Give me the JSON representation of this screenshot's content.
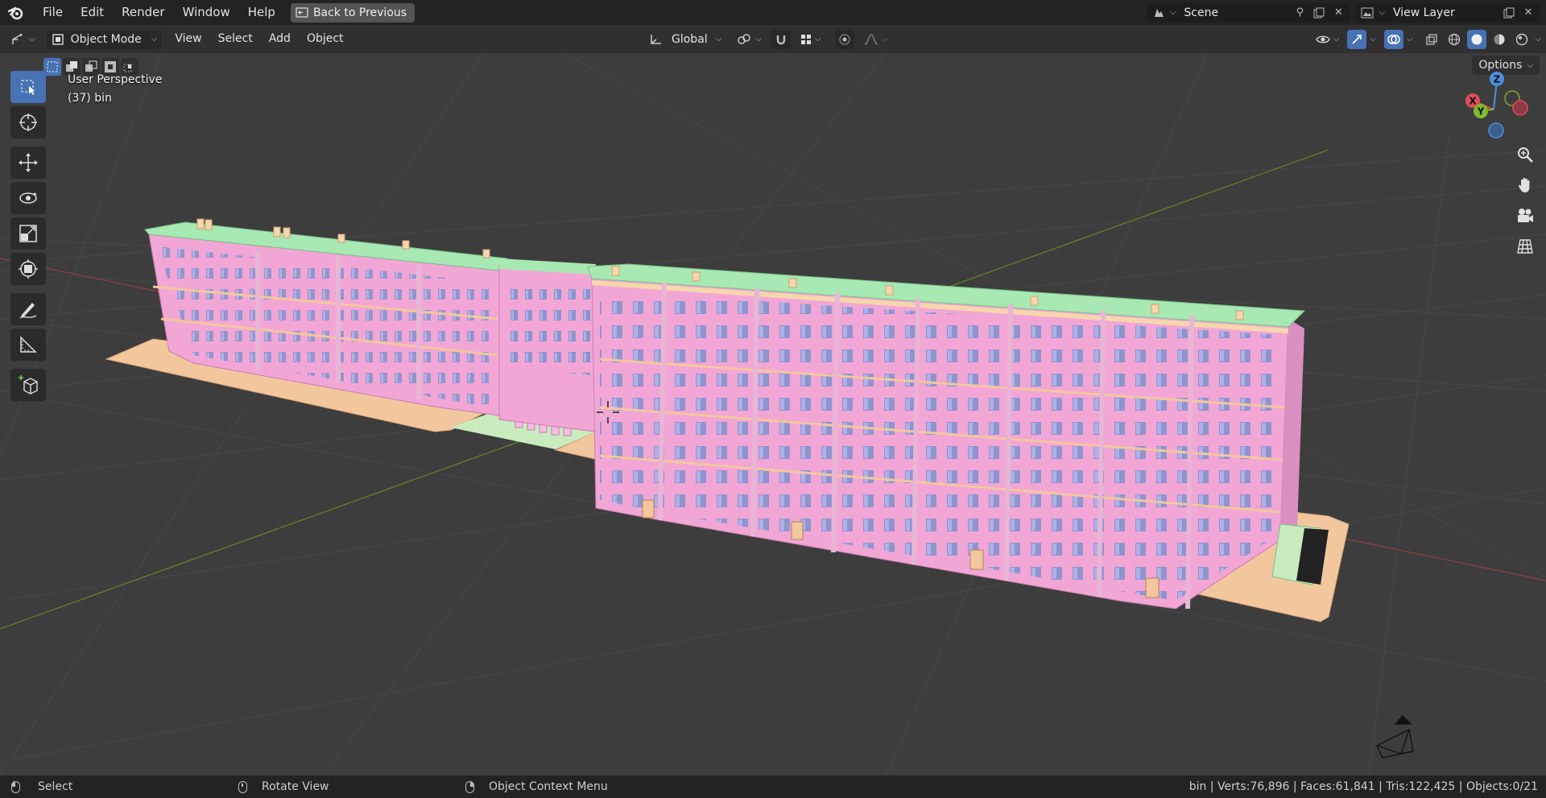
{
  "menu": {
    "items": [
      "File",
      "Edit",
      "Render",
      "Window",
      "Help"
    ],
    "back_label": "Back to Previous"
  },
  "scene": {
    "name": "Scene",
    "view_layer": "View Layer"
  },
  "header": {
    "mode": "Object Mode",
    "menus": [
      "View",
      "Select",
      "Add",
      "Object"
    ],
    "transform_orientation": "Global",
    "options_label": "Options"
  },
  "viewport": {
    "perspective": "User Perspective",
    "object_info": "(37) bin",
    "gizmo_labels": {
      "z": "Z",
      "x": "X",
      "y": "Y"
    },
    "colors": {
      "wall": "#f2a6d6",
      "roof": "#a8e8b2",
      "ground": "#f3c79d",
      "grid": "#474747"
    }
  },
  "status": {
    "left_action": "Select",
    "middle_action": "Rotate View",
    "right_action": "Object Context Menu",
    "stats": "bin | Verts:76,896 | Faces:61,841 | Tris:122,425 | Objects:0/21"
  }
}
